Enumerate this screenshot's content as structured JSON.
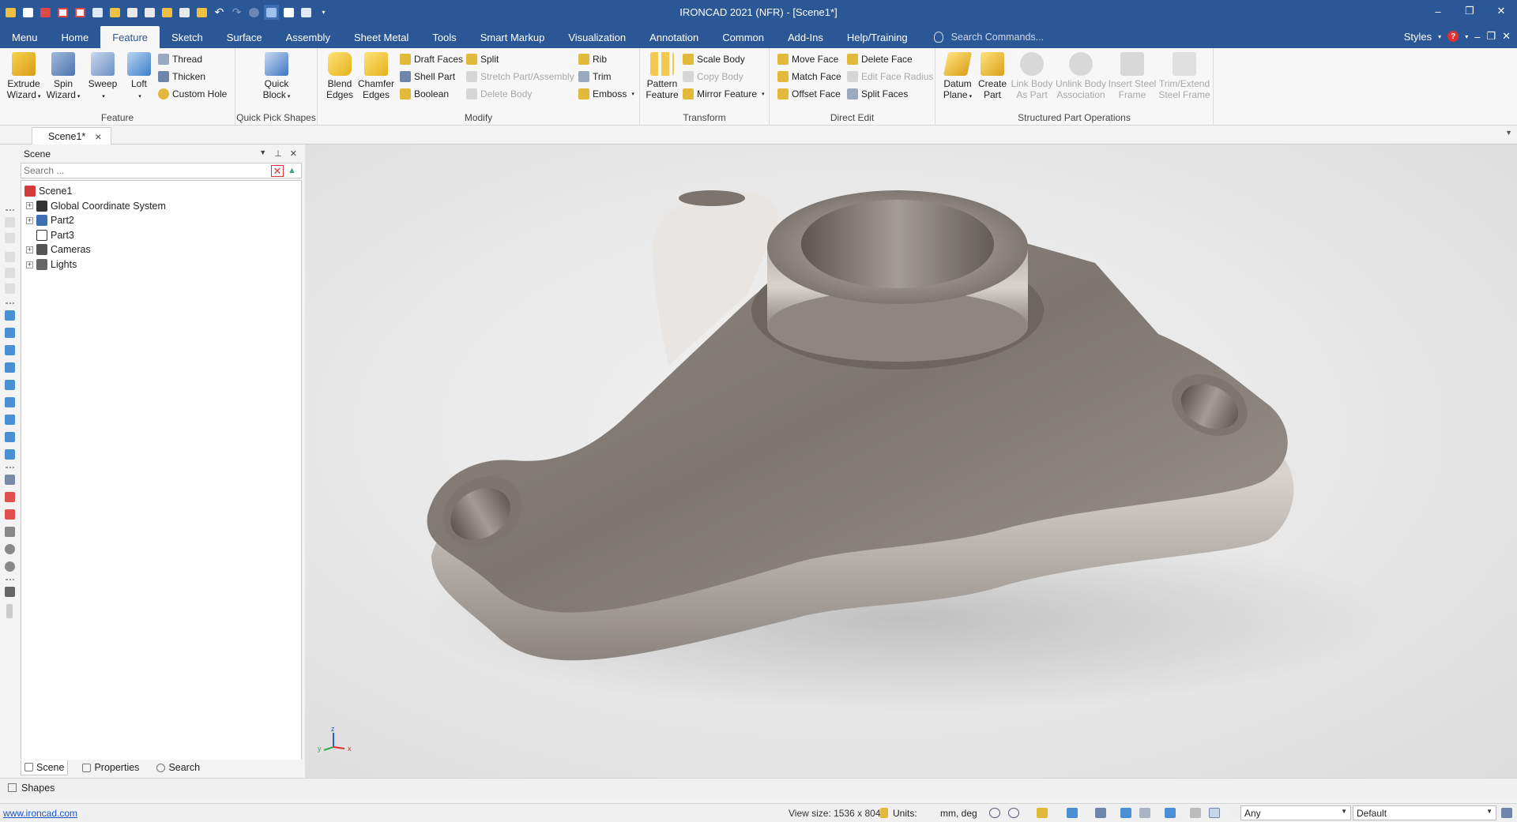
{
  "app": {
    "title": "IRONCAD 2021 (NFR) - [Scene1*]",
    "window_controls": [
      "–",
      "❐",
      "✕"
    ]
  },
  "colors": {
    "title_bar": "#2b5797",
    "ribbon_bg": "#f7f7f7",
    "link": "#1a55c8"
  },
  "menu": {
    "tabs": [
      "Menu",
      "Home",
      "Feature",
      "Sketch",
      "Surface",
      "Assembly",
      "Sheet Metal",
      "Tools",
      "Smart Markup",
      "Visualization",
      "Annotation",
      "Common",
      "Add-Ins",
      "Help/Training"
    ],
    "active": "Feature",
    "search_placeholder": "Search Commands...",
    "styles_label": "Styles",
    "right_controls": [
      "–",
      "❐",
      "✕"
    ]
  },
  "ribbon": {
    "feature": {
      "label": "Feature",
      "extrude": "Extrude\nWizard",
      "spin": "Spin\nWizard",
      "sweep": "Sweep",
      "loft": "Loft",
      "thread": "Thread",
      "thicken": "Thicken",
      "custom_hole": "Custom Hole"
    },
    "quick_pick": {
      "label": "Quick Pick Shapes",
      "quick_block": "Quick\nBlock"
    },
    "modify": {
      "label": "Modify",
      "blend": "Blend\nEdges",
      "chamfer": "Chamfer\nEdges",
      "draft_faces": "Draft Faces",
      "shell_part": "Shell Part",
      "boolean": "Boolean",
      "split": "Split",
      "stretch": "Stretch Part/Assembly",
      "delete_body": "Delete Body",
      "rib": "Rib",
      "trim": "Trim",
      "emboss": "Emboss"
    },
    "transform": {
      "label": "Transform",
      "pattern": "Pattern\nFeature",
      "scale_body": "Scale Body",
      "copy_body": "Copy Body",
      "mirror_feature": "Mirror Feature"
    },
    "direct_edit": {
      "label": "Direct Edit",
      "move_face": "Move Face",
      "match_face": "Match Face",
      "offset_face": "Offset Face",
      "delete_face": "Delete Face",
      "edit_face_radius": "Edit Face Radius",
      "split_faces": "Split Faces"
    },
    "structured": {
      "label": "Structured Part Operations",
      "datum_plane": "Datum\nPlane",
      "create_part": "Create\nPart",
      "link_body": "Link Body\nAs Part",
      "unlink_body": "Unlink Body\nAssociation",
      "insert_steel": "Insert Steel\nFrame",
      "trim_steel": "Trim/Extend\nSteel Frame"
    }
  },
  "doc_tab": {
    "name": "Scene1*",
    "close": "×"
  },
  "scene_panel": {
    "title": "Scene",
    "search_placeholder": "Search ...",
    "tree": [
      {
        "label": "Scene1",
        "icon": "scene-icon",
        "expandable": false,
        "indent": 0
      },
      {
        "label": "Global Coordinate System",
        "icon": "axes-icon",
        "expandable": true,
        "indent": 1
      },
      {
        "label": "Part2",
        "icon": "part-icon",
        "expandable": true,
        "indent": 1
      },
      {
        "label": "Part3",
        "icon": "part-outline-icon",
        "expandable": false,
        "indent": 1
      },
      {
        "label": "Cameras",
        "icon": "camera-icon",
        "expandable": true,
        "indent": 1
      },
      {
        "label": "Lights",
        "icon": "light-icon",
        "expandable": true,
        "indent": 1
      }
    ],
    "tabs": [
      "Scene",
      "Properties",
      "Search"
    ],
    "active_tab": "Scene"
  },
  "shapes_bar": {
    "label": "Shapes"
  },
  "status": {
    "link": "www.ironcad.com",
    "view_size": "View size: 1536 x  804",
    "units_label": "Units:",
    "units_value": "mm, deg",
    "filter_value": "Any",
    "style_value": "Default"
  },
  "axis_labels": {
    "z": "z",
    "y": "y",
    "x": "x"
  }
}
